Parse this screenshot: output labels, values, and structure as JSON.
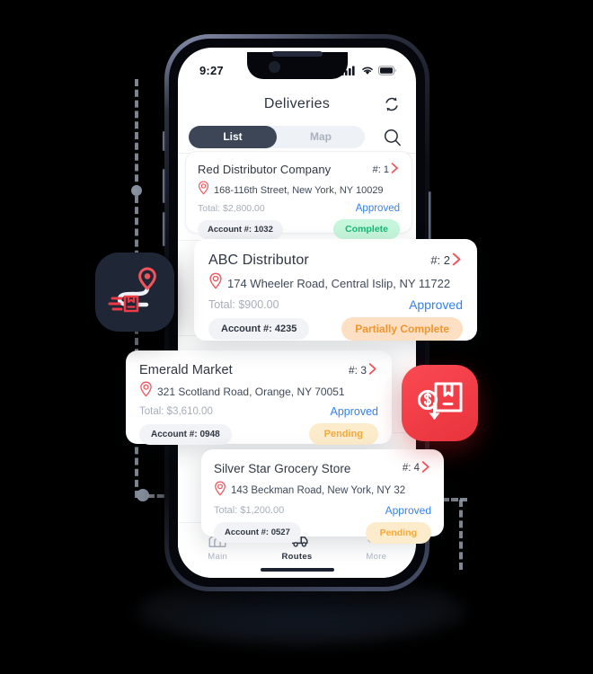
{
  "app": {
    "status_bar": {
      "time": "9:27",
      "icons": [
        "cellular-signal-icon",
        "wifi-icon",
        "battery-icon"
      ]
    },
    "header": {
      "title": "Deliveries",
      "refresh_icon": "refresh-icon"
    },
    "toolbar": {
      "segments": [
        {
          "label": "List",
          "active": true
        },
        {
          "label": "Map",
          "active": false
        }
      ],
      "search_icon": "search-icon"
    },
    "tabbar": {
      "tabs": [
        {
          "label": "Main",
          "icon": "home-icon",
          "active": false
        },
        {
          "label": "Routes",
          "icon": "truck-icon",
          "active": true
        },
        {
          "label": "More",
          "icon": "ellipsis-icon",
          "active": false
        }
      ]
    },
    "deliveries": [
      {
        "name": "Red  Distributor Company",
        "index_label": "#: 1",
        "address": "168-116th Street, New York, NY 10029",
        "total": "Total: $2,800.00",
        "approval": "Approved",
        "account": "Account #: 1032",
        "status": "Complete"
      },
      {
        "name": "ABC Distributor",
        "index_label": "#: 2",
        "address": "174 Wheeler Road, Central Islip, NY 11722",
        "total": "Total: $900.00",
        "approval": "Approved",
        "account": "Account #: 4235",
        "status": "Partially Complete"
      },
      {
        "name": "Emerald Market",
        "index_label": "#: 3",
        "address": "321 Scotland Road, Orange, NY 70051",
        "total": "Total: $3,610.00",
        "approval": "Approved",
        "account": "Account #: 0948",
        "status": "Pending"
      },
      {
        "name": "Silver Star Grocery Store",
        "index_label": "#: 4",
        "address": "143 Beckman Road, New York, NY 32",
        "total": "Total: $1,200.00",
        "approval": "Approved",
        "account": "Account #: 0527",
        "status": "Pending"
      }
    ],
    "badges": [
      {
        "icon": "route-delivery-icon",
        "background": "#1f2737"
      },
      {
        "icon": "package-cost-down-icon",
        "background": "#ef3b44"
      }
    ],
    "colors": {
      "accent_red": "#e8333d",
      "approved_blue": "#3481f5",
      "complete_green": "#17b877",
      "partial_orange": "#f2952e",
      "pending_amber": "#f5a93c",
      "segment_active": "#3c4656",
      "segment_track": "#eef1f5",
      "text_dark": "#2f3642",
      "text_muted": "#a7aeba",
      "page_background": "#000000"
    }
  }
}
